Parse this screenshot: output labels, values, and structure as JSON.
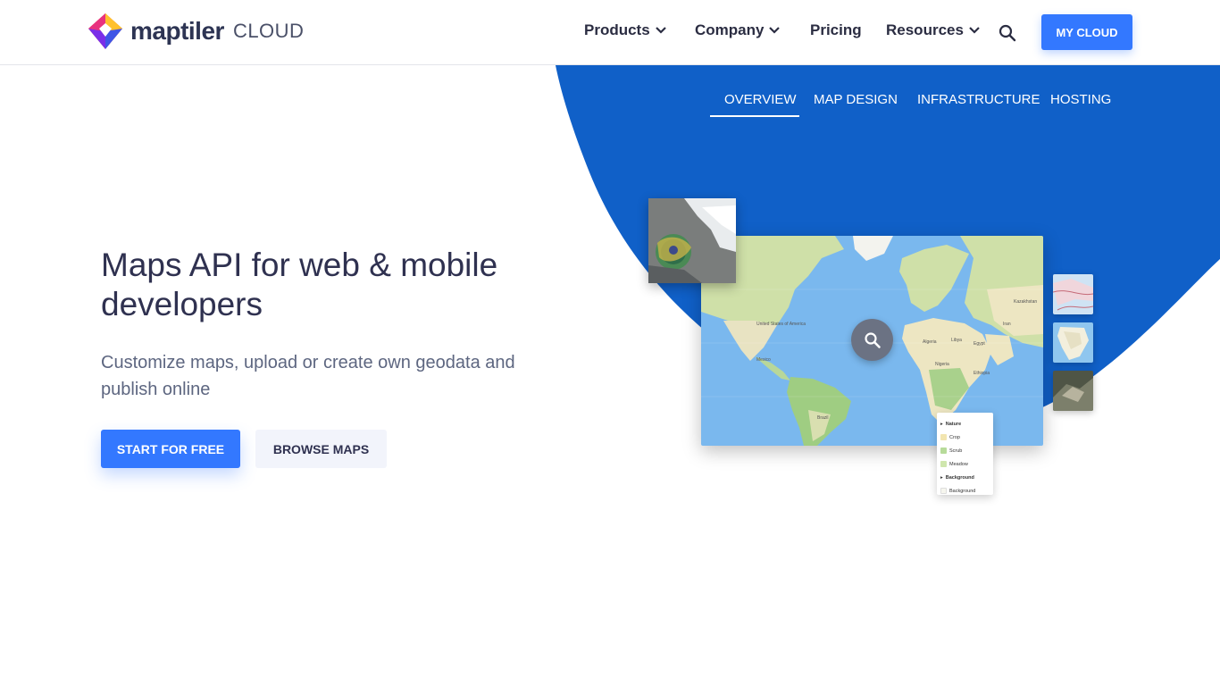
{
  "header": {
    "brand_name": "maptiler",
    "brand_sub": "CLOUD",
    "nav": [
      {
        "label": "Products",
        "has_dropdown": true
      },
      {
        "label": "Company",
        "has_dropdown": true
      },
      {
        "label": "Pricing",
        "has_dropdown": false
      },
      {
        "label": "Resources",
        "has_dropdown": true
      }
    ],
    "search_icon": "search-icon",
    "cta_label": "MY CLOUD"
  },
  "subnav": {
    "items": [
      "OVERVIEW",
      "MAP DESIGN",
      "INFRASTRUCTURE",
      "HOSTING"
    ],
    "active": "OVERVIEW"
  },
  "hero": {
    "title": "Maps API for web & mobile developers",
    "subtitle": "Customize maps, upload or create own geodata and publish online",
    "primary_button": "START FOR FREE",
    "secondary_button": "BROWSE MAPS"
  },
  "illustration": {
    "legend": {
      "groups": [
        {
          "title": "Nature",
          "items": [
            "Crop",
            "Scrub",
            "Meadow"
          ]
        },
        {
          "title": "Background",
          "items": [
            "Background"
          ]
        }
      ]
    },
    "map_labels": [
      "United States of America",
      "Mexico",
      "Brazil",
      "Kazakhstan",
      "Algeria",
      "Libya",
      "Egypt",
      "Nigeria",
      "Iran",
      "Ethiopia"
    ]
  },
  "colors": {
    "accent": "#3378ff",
    "hero_blob": "#1060c8",
    "heading": "#2f3150",
    "body_text": "#5d6680"
  }
}
